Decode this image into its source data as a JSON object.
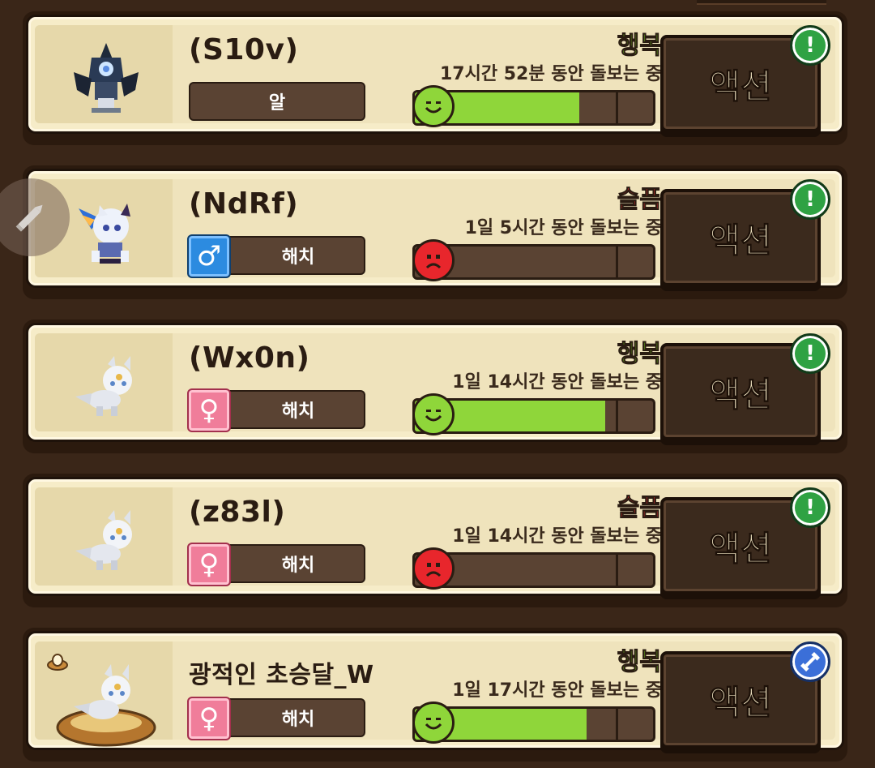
{
  "pets": [
    {
      "name": "(S10v)",
      "stage": "알",
      "gender": "",
      "mood": "행복",
      "mood_type": "happy",
      "care_time": "17시간 52분 동안 돌보는 중",
      "happiness": 0.69,
      "action_label": "액션",
      "badge": "alert"
    },
    {
      "name": "(NdRf)",
      "stage": "해치",
      "gender": "♂",
      "mood": "슬픔",
      "mood_type": "sad",
      "care_time": "1일 5시간 동안 돌보는 중",
      "happiness": 0.0,
      "action_label": "액션",
      "badge": "alert"
    },
    {
      "name": "(Wx0n)",
      "stage": "해치",
      "gender": "♀",
      "mood": "행복",
      "mood_type": "happy",
      "care_time": "1일 14시간 동안 돌보는 중",
      "happiness": 0.8,
      "action_label": "액션",
      "badge": "alert"
    },
    {
      "name": "(z83l)",
      "stage": "해치",
      "gender": "♀",
      "mood": "슬픔",
      "mood_type": "sad",
      "care_time": "1일 14시간 동안 돌보는 중",
      "happiness": 0.0,
      "action_label": "액션",
      "badge": "alert"
    },
    {
      "name": "광적인 초승달_W",
      "stage": "해치",
      "gender": "♀",
      "mood": "행복",
      "mood_type": "happy",
      "care_time": "1일 17시간 동안 돌보는 중",
      "happiness": 0.72,
      "action_label": "액션",
      "badge": "training"
    }
  ],
  "alert_symbol": "!",
  "colors": {
    "happy": "#8fd63a",
    "sad": "#e8262c",
    "background": "#3a2618",
    "card": "#f6ecc8"
  }
}
